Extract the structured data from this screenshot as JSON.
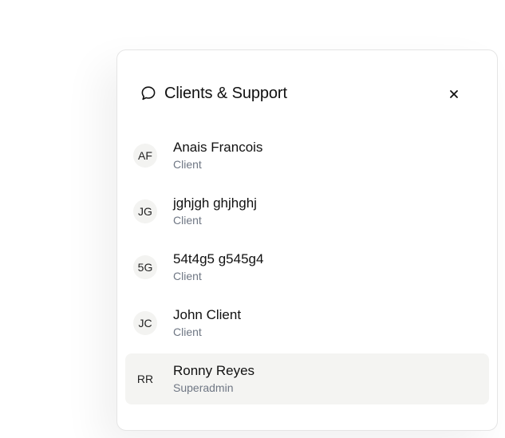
{
  "panel": {
    "title": "Clients & Support",
    "title_icon": "chat-bubble-icon",
    "close_icon": "close-icon",
    "close_label": "×"
  },
  "contacts": [
    {
      "initials": "AF",
      "name": "Anais Francois",
      "role": "Client",
      "active": false
    },
    {
      "initials": "JG",
      "name": "jghjgh ghjhghj",
      "role": "Client",
      "active": false
    },
    {
      "initials": "5G",
      "name": "54t4g5 g545g4",
      "role": "Client",
      "active": false
    },
    {
      "initials": "JC",
      "name": "John Client",
      "role": "Client",
      "active": false
    },
    {
      "initials": "RR",
      "name": "Ronny Reyes",
      "role": "Superadmin",
      "active": true
    }
  ],
  "colors": {
    "active_row_bg": "#f4f4f2",
    "role_text": "#6f7784",
    "avatar_bg": "#f3f3f1"
  }
}
